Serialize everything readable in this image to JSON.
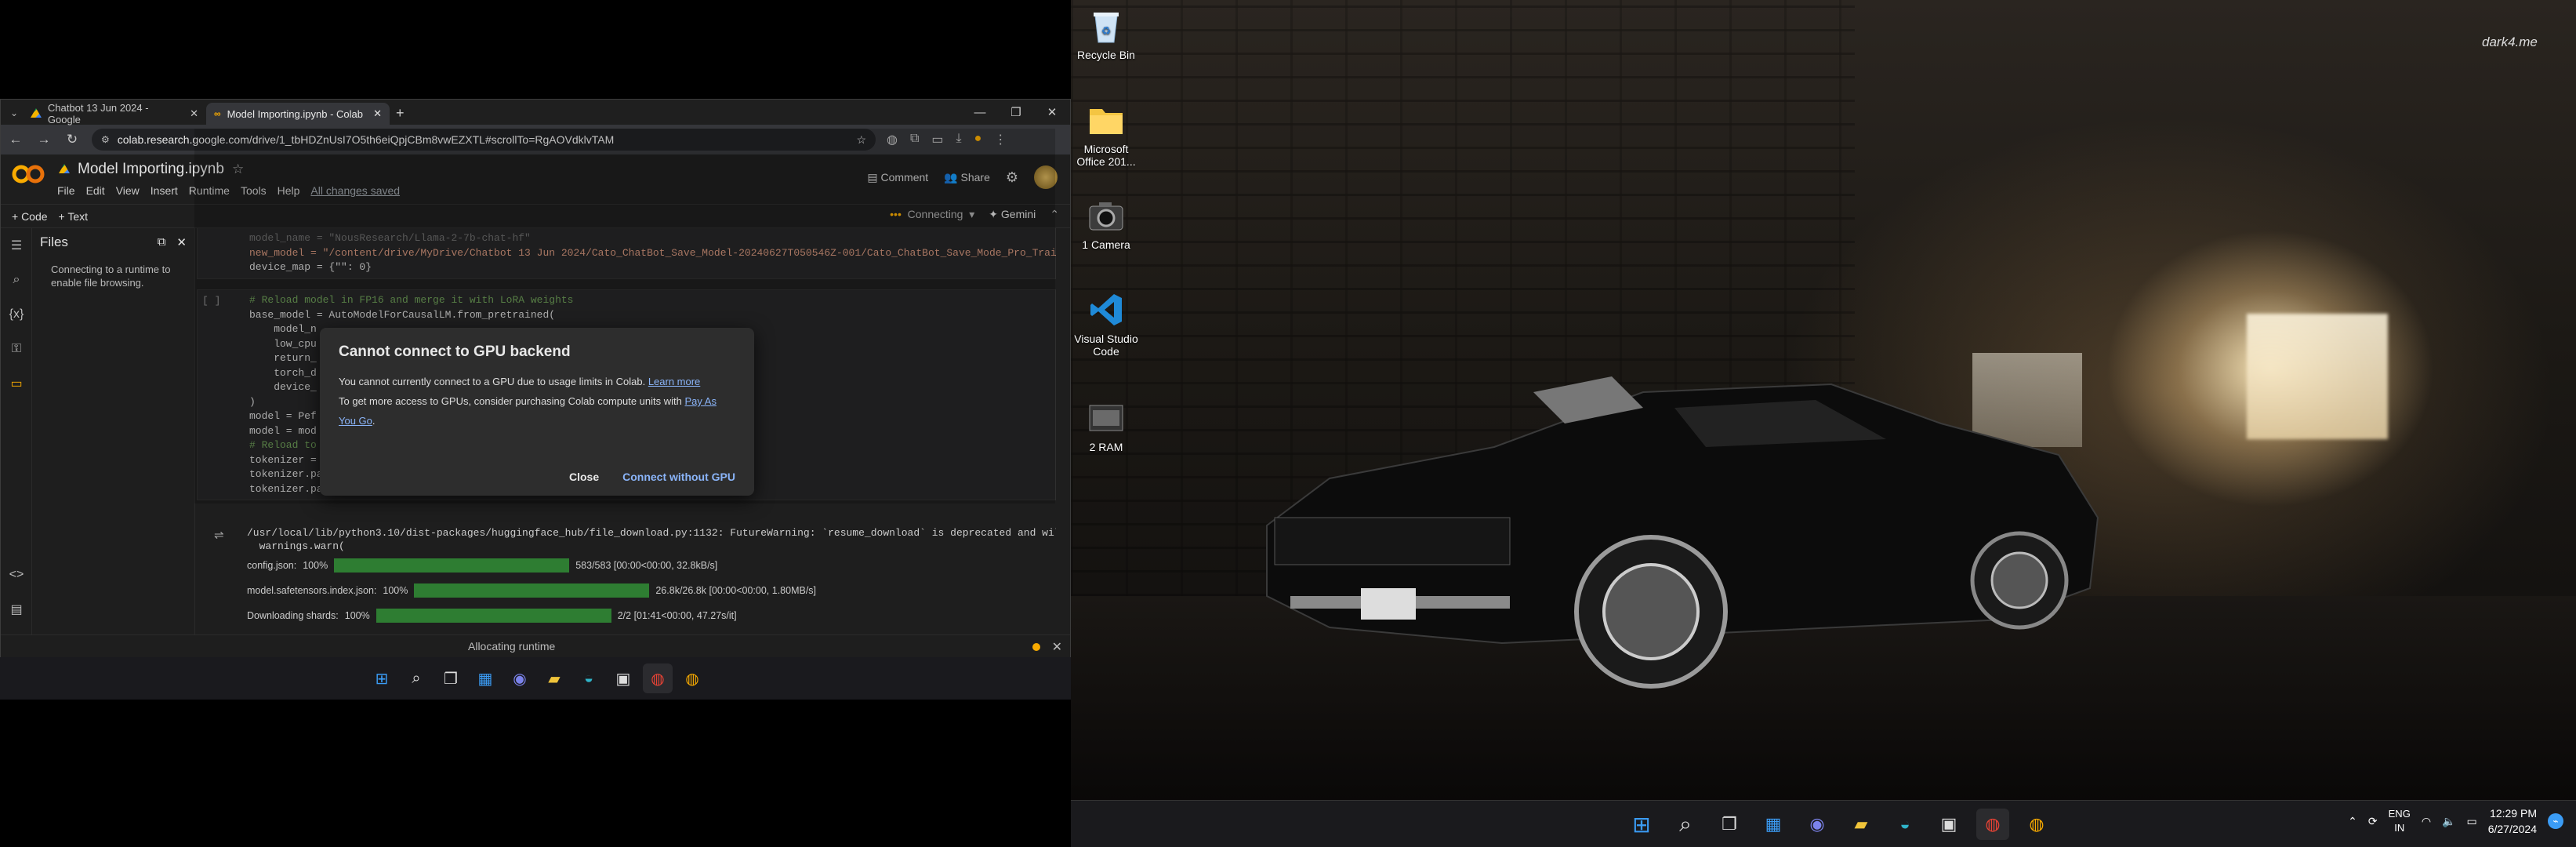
{
  "desktop": {
    "watermark": "dark4.me",
    "icons": [
      {
        "label": "Recycle Bin",
        "icon": "recycle-bin-icon"
      },
      {
        "label": "Microsoft Office 201...",
        "icon": "folder-icon"
      },
      {
        "label": "1 Camera",
        "icon": "camera-icon"
      },
      {
        "label": "Visual Studio Code",
        "icon": "vscode-icon"
      },
      {
        "label": "2 RAM",
        "icon": "video-file-icon"
      }
    ]
  },
  "browser": {
    "tabs": [
      {
        "title": "Chatbot 13 Jun 2024 - Google",
        "icon": "google-drive-icon"
      },
      {
        "title": "Model Importing.ipynb - Colab",
        "icon": "colab-icon"
      }
    ],
    "new_tab": "+",
    "url": "colab.research.google.com/drive/1_tbHDZnUsI7O5th6eiQpjCBm8vwEZXTL#scrollTo=RgAOVdklvTAM"
  },
  "colab": {
    "notebook_title": "Model Importing.ipynb",
    "menu": [
      "File",
      "Edit",
      "View",
      "Insert",
      "Runtime",
      "Tools",
      "Help"
    ],
    "saved_status": "All changes saved",
    "comment_label": "Comment",
    "share_label": "Share",
    "add_code": "+ Code",
    "add_text": "+ Text",
    "connect_status": "Connecting",
    "gemini_label": "Gemini",
    "files_title": "Files",
    "files_message": "Connecting to a runtime to enable file browsing.",
    "code_top": [
      "model_name = \"NousResearch/Llama-2-7b-chat-hf\"",
      "new_model = \"/content/drive/MyDrive/Chatbot 13 Jun 2024/Cato_ChatBot_Save_Model-20240627T050546Z-001/Cato_ChatBot_Save_Mode_Pro_Train",
      "device_map = {\"\": 0}"
    ],
    "cell2_run": "[ ]",
    "code_cell2": [
      "# Reload model in FP16 and merge it with LoRA weights",
      "base_model = AutoModelForCausalLM.from_pretrained(",
      "    model_n",
      "    low_cpu",
      "    return_",
      "    torch_d",
      "    device_",
      ")",
      "model = Pef",
      "model = mod",
      "",
      "# Reload to",
      "tokenizer =",
      "tokenizer.pad_token = tokenizer.eos_token",
      "tokenizer.padding_side = \"right\""
    ],
    "warning_lines": [
      "/usr/local/lib/python3.10/dist-packages/huggingface_hub/file_download.py:1132: FutureWarning: `resume_download` is deprecated and will",
      "  warnings.warn("
    ],
    "progress": [
      {
        "label": "config.json:",
        "pct": "100%",
        "fill": 1.0,
        "stats": "583/583 [00:00<00:00, 32.8kB/s]"
      },
      {
        "label": "model.safetensors.index.json:",
        "pct": "100%",
        "fill": 1.0,
        "stats": "26.8k/26.8k [00:00<00:00, 1.80MB/s]"
      },
      {
        "label": "Downloading shards:",
        "pct": "100%",
        "fill": 1.0,
        "stats": "2/2 [01:41<00:00, 47.27s/it]"
      }
    ],
    "status_text": "Allocating runtime"
  },
  "dialog": {
    "title": "Cannot connect to GPU backend",
    "line1": "You cannot currently connect to a GPU due to usage limits in Colab.",
    "line1_link": "Learn more",
    "line2": "To get more access to GPUs, consider purchasing Colab compute units with",
    "line2_link": "Pay As You Go",
    "line2_end": ".",
    "close_label": "Close",
    "connect_label": "Connect without GPU"
  },
  "tray": {
    "lang": "ENG",
    "region": "IN",
    "time": "12:29 PM",
    "date": "6/27/2024"
  }
}
